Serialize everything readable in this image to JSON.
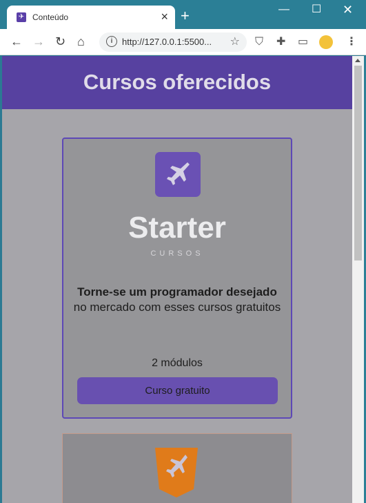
{
  "browser": {
    "tab_title": "Conteúdo",
    "url": "http://127.0.0.1:5500...",
    "window_controls": [
      "minimize",
      "maximize",
      "close"
    ]
  },
  "page": {
    "header_title": "Cursos oferecidos",
    "cards": [
      {
        "logo_icon": "plane-icon",
        "name": "Starter",
        "kind": "CURSOS",
        "desc_bold": "Torne-se um programador desejado",
        "desc_rest": "no mercado com esses cursos gratuitos",
        "modules": "2 módulos",
        "cta": "Curso gratuito",
        "accent": "#5d48b6"
      },
      {
        "logo_icon": "html5-shield-icon",
        "accent": "#e07b1a"
      }
    ]
  },
  "colors": {
    "header_bg": "#5741a0",
    "page_bg": "#a6a5aa",
    "button_bg": "#6850b0",
    "titlebar": "#2b7f96"
  }
}
